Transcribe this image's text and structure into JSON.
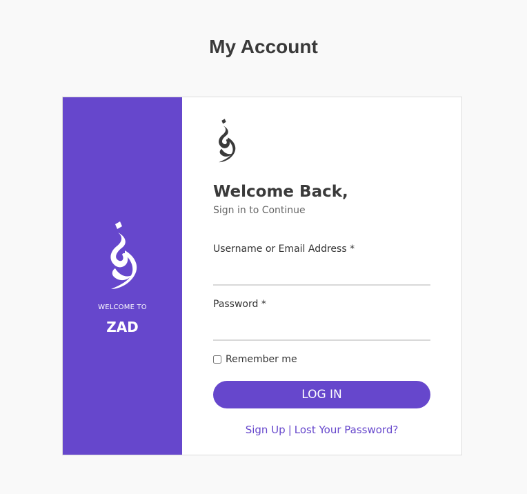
{
  "page": {
    "title": "My Account"
  },
  "brand_panel": {
    "welcome_to": "WELCOME TO",
    "brand_name": "ZAD",
    "logo_icon": "calligraphy-logo-icon",
    "background_color": "#6647cc",
    "logo_color": "#ffffff"
  },
  "login_form": {
    "logo_icon": "calligraphy-logo-icon",
    "logo_color": "#3a3a3a",
    "heading": "Welcome Back,",
    "subheading": "Sign in to Continue",
    "username_label": "Username or Email Address *",
    "username_value": "",
    "password_label": "Password *",
    "password_value": "",
    "remember_label": "Remember me",
    "remember_checked": false,
    "login_button_label": "LOG IN",
    "signup_link": "Sign Up",
    "separator": "|",
    "lost_password_link": "Lost Your Password?",
    "accent_color": "#6647cc"
  }
}
